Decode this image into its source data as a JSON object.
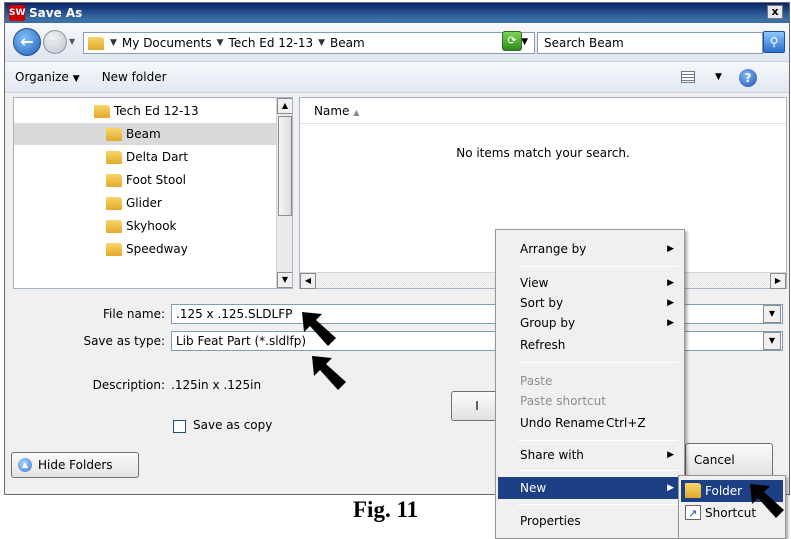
{
  "window": {
    "title": "Save As",
    "app_icon_text": "SW",
    "close_label": "x"
  },
  "address_bar": {
    "crumbs": [
      "My Documents",
      "Tech Ed 12-13",
      "Beam"
    ],
    "search_placeholder": "Search Beam"
  },
  "command_bar": {
    "organize_label": "Organize",
    "new_folder_label": "New folder"
  },
  "tree": {
    "items": [
      {
        "label": "Tech Ed 12-13",
        "selected": false
      },
      {
        "label": "Beam",
        "selected": true
      },
      {
        "label": "Delta Dart",
        "selected": false
      },
      {
        "label": "Foot Stool",
        "selected": false
      },
      {
        "label": "Glider",
        "selected": false
      },
      {
        "label": "Skyhook",
        "selected": false
      },
      {
        "label": "Speedway",
        "selected": false
      }
    ]
  },
  "file_list": {
    "column_name": "Name",
    "empty_message": "No items match your search."
  },
  "form": {
    "file_name_label": "File name:",
    "file_name_value": ".125 x .125.SLDLFP",
    "save_type_label": "Save as type:",
    "save_type_value": "Lib Feat Part (*.sldlfp)",
    "description_label": "Description:",
    "description_value": ".125in x .125in",
    "save_as_copy_label": "Save as copy",
    "save_as_copy_checked": false,
    "hide_folders_label": "Hide Folders",
    "cancel_label": "Cancel",
    "save_button_partial": "I"
  },
  "context_menu": {
    "items": [
      {
        "label": "Arrange by",
        "submenu": true,
        "disabled": false
      },
      {
        "label": "View",
        "submenu": true,
        "disabled": false
      },
      {
        "label": "Sort by",
        "submenu": true,
        "disabled": false
      },
      {
        "label": "Group by",
        "submenu": true,
        "disabled": false
      },
      {
        "label": "Refresh",
        "submenu": false,
        "disabled": false
      },
      {
        "label": "Paste",
        "submenu": false,
        "disabled": true
      },
      {
        "label": "Paste shortcut",
        "submenu": false,
        "disabled": true
      },
      {
        "label": "Undo Rename",
        "shortcut": "Ctrl+Z",
        "submenu": false,
        "disabled": false
      },
      {
        "label": "Share with",
        "submenu": true,
        "disabled": false
      },
      {
        "label": "New",
        "submenu": true,
        "disabled": false,
        "highlighted": true
      },
      {
        "label": "Properties",
        "submenu": false,
        "disabled": false
      }
    ]
  },
  "new_submenu": {
    "items": [
      {
        "label": "Folder",
        "highlighted": true
      },
      {
        "label": "Shortcut",
        "highlighted": false
      }
    ]
  },
  "caption": "Fig. 11",
  "colors": {
    "titlebar": "#0a246a",
    "menu_highlight": "#1c3f86",
    "tree_selected": "#dadada"
  }
}
